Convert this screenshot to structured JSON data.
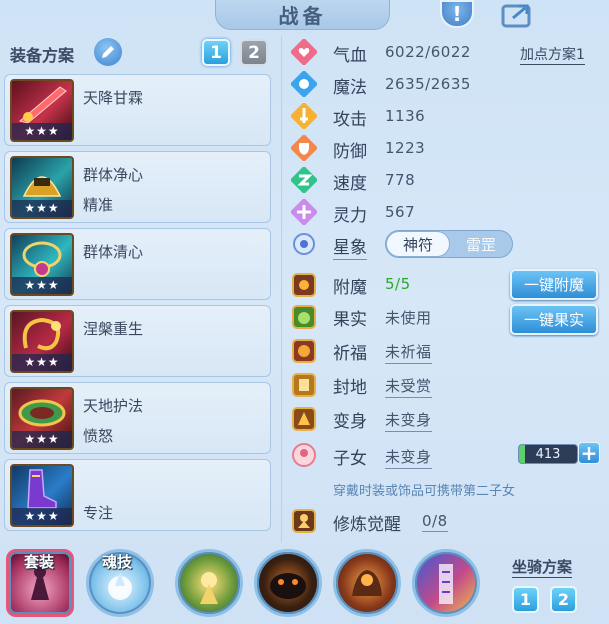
{
  "header": {
    "title": "战备"
  },
  "equipment_plan": {
    "label": "装备方案",
    "tabs": [
      "1",
      "2"
    ],
    "active_tab": "1"
  },
  "equipment": [
    {
      "name": "天降甘霖",
      "sub": "",
      "stars": "★★★",
      "icon": "red-blade-icon"
    },
    {
      "name": "群体净心",
      "sub": "精准",
      "stars": "★★★",
      "icon": "golden-helm-icon"
    },
    {
      "name": "群体清心",
      "sub": "",
      "stars": "★★★",
      "icon": "jade-necklace-icon"
    },
    {
      "name": "涅槃重生",
      "sub": "",
      "stars": "★★★",
      "icon": "gold-ring-icon"
    },
    {
      "name": "天地护法",
      "sub": "愤怒",
      "stars": "★★★",
      "icon": "belt-icon"
    },
    {
      "name": "",
      "sub": "专注",
      "stars": "★★★",
      "icon": "boots-icon"
    }
  ],
  "attributes": {
    "add_plan_label": "加点方案1",
    "items": [
      {
        "label": "气血",
        "value": "6022/6022",
        "icon": "heart-icon",
        "color": "#e0567a"
      },
      {
        "label": "魔法",
        "value": "2635/2635",
        "icon": "mana-icon",
        "color": "#3aa5ee"
      },
      {
        "label": "攻击",
        "value": "1136",
        "icon": "sword-icon",
        "color": "#f0a12a"
      },
      {
        "label": "防御",
        "value": "1223",
        "icon": "shield-icon",
        "color": "#f07a3a"
      },
      {
        "label": "速度",
        "value": "778",
        "icon": "speed-icon",
        "color": "#2ec48a"
      },
      {
        "label": "灵力",
        "value": "567",
        "icon": "spirit-icon",
        "color": "#c076e8"
      }
    ],
    "star_image": {
      "label": "星象",
      "options": [
        "神符",
        "雷罡"
      ],
      "selected": "神符"
    }
  },
  "enhance": [
    {
      "label": "附魔",
      "value": "5/5",
      "icon": "enchant-icon",
      "button": "一键附魔"
    },
    {
      "label": "果实",
      "value": "未使用",
      "icon": "fruit-icon",
      "button": "一键果实"
    },
    {
      "label": "祈福",
      "value": "未祈福",
      "icon": "blessing-icon"
    },
    {
      "label": "封地",
      "value": "未受赏",
      "icon": "fief-icon"
    },
    {
      "label": "变身",
      "value": "未变身",
      "icon": "transform-icon"
    },
    {
      "label": "子女",
      "value": "未变身",
      "icon": "child-icon",
      "bar_value": "413"
    }
  ],
  "hint": "穿戴时装或饰品可携带第二子女",
  "cultivation": {
    "label": "修炼觉醒",
    "value": "0/8",
    "icon": "cultivation-icon"
  },
  "bottom": {
    "skills": [
      {
        "label": "套装",
        "icon": "suit-skill-icon"
      },
      {
        "label": "魂技",
        "icon": "soul-skill-icon"
      },
      {
        "label": "",
        "icon": "golden-light-icon"
      },
      {
        "label": "",
        "icon": "dark-beast-icon"
      },
      {
        "label": "",
        "icon": "flame-beast-icon"
      },
      {
        "label": "",
        "icon": "rune-pillar-icon"
      }
    ],
    "mount_label": "坐骑方案",
    "mount_tabs": [
      "1",
      "2"
    ]
  }
}
